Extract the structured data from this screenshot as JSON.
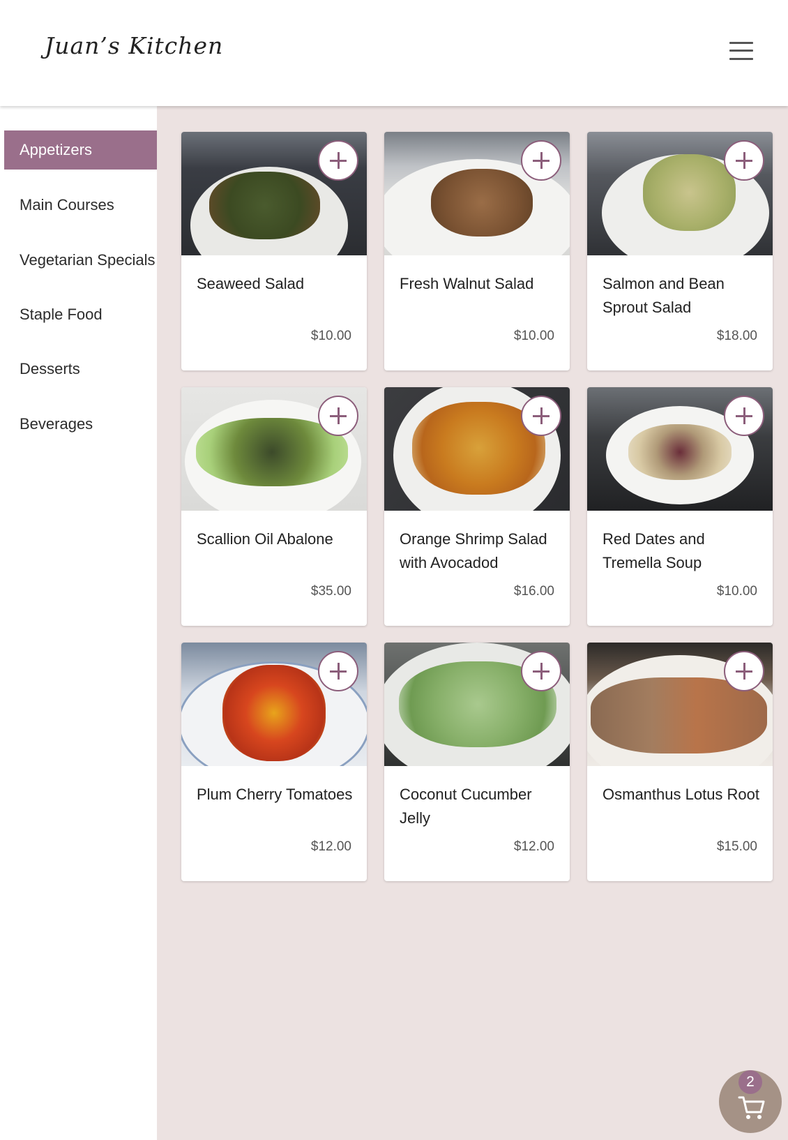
{
  "header": {
    "brand": "Juan’s Kitchen",
    "menu_icon": "hamburger-menu-icon"
  },
  "sidebar": {
    "items": [
      {
        "label": "Appetizers",
        "active": true
      },
      {
        "label": "Main Courses",
        "active": false
      },
      {
        "label": "Vegetarian Specials",
        "active": false
      },
      {
        "label": "Staple Food",
        "active": false
      },
      {
        "label": "Desserts",
        "active": false
      },
      {
        "label": "Beverages",
        "active": false
      }
    ]
  },
  "dishes": [
    {
      "name": "Seaweed Salad",
      "price": "$10.00"
    },
    {
      "name": "Fresh Walnut Salad",
      "price": "$10.00"
    },
    {
      "name": "Salmon and Bean Sprout Salad",
      "price": "$18.00"
    },
    {
      "name": "Scallion Oil Abalone",
      "price": "$35.00"
    },
    {
      "name": "Orange Shrimp Salad with Avocadod",
      "price": "$16.00"
    },
    {
      "name": "Red Dates and Tremella Soup",
      "price": "$10.00"
    },
    {
      "name": "Plum Cherry Tomatoes",
      "price": "$12.00"
    },
    {
      "name": "Coconut Cucumber Jelly",
      "price": "$12.00"
    },
    {
      "name": "Osmanthus Lotus Root",
      "price": "$15.00"
    }
  ],
  "cart": {
    "count": "2",
    "icon": "shopping-cart-icon"
  },
  "colors": {
    "accent": "#9a6f8b",
    "content_bg": "#ece2e1",
    "cart_bg": "#a59286"
  }
}
